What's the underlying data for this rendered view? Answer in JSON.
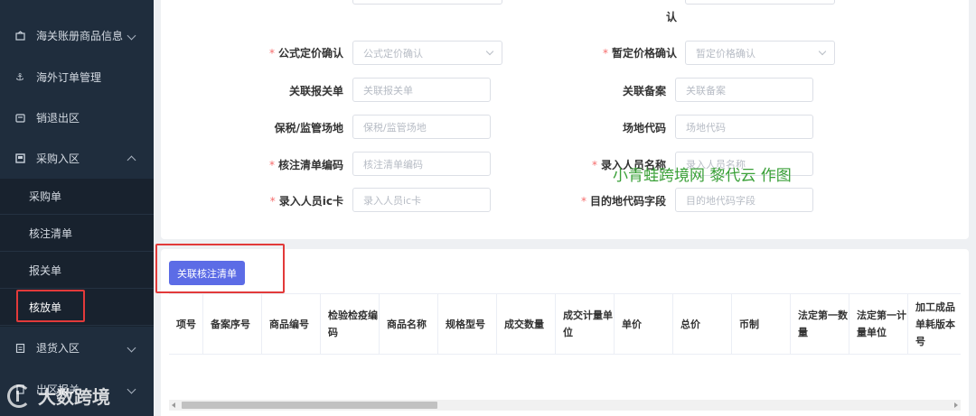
{
  "sidebar": {
    "menu": [
      {
        "label": "海关账册商品信息",
        "icon": "box-icon"
      },
      {
        "label": "海外订单管理",
        "icon": "anchor-icon"
      },
      {
        "label": "销退出区",
        "icon": "return-icon"
      },
      {
        "label": "采购入区",
        "icon": "square-icon",
        "expanded": true
      }
    ],
    "submenu": [
      "采购单",
      "核注清单",
      "报关单",
      "核放单"
    ],
    "active_submenu": "核放单",
    "menu_after": [
      {
        "label": "退货入区",
        "icon": "clipboard-icon"
      },
      {
        "label": "出区报关",
        "icon": "doc-icon"
      }
    ]
  },
  "form": {
    "partial_tail": "认",
    "rows": [
      {
        "left": {
          "label": "公式定价确认",
          "required": true,
          "placeholder": "公式定价确认",
          "type": "select"
        },
        "right": {
          "label": "暂定价格确认",
          "required": true,
          "placeholder": "暂定价格确认",
          "type": "select"
        }
      },
      {
        "left": {
          "label": "关联报关单",
          "required": false,
          "placeholder": "关联报关单",
          "type": "input"
        },
        "right": {
          "label": "关联备案",
          "required": false,
          "placeholder": "关联备案",
          "type": "input"
        }
      },
      {
        "left": {
          "label": "保税/监管场地",
          "required": false,
          "placeholder": "保税/监管场地",
          "type": "input"
        },
        "right": {
          "label": "场地代码",
          "required": false,
          "placeholder": "场地代码",
          "type": "input"
        }
      },
      {
        "left": {
          "label": "核注清单编码",
          "required": true,
          "placeholder": "核注清单编码",
          "type": "input"
        },
        "right": {
          "label": "录入人员名称",
          "required": true,
          "placeholder": "录入人员名称",
          "type": "input"
        }
      },
      {
        "left": {
          "label": "录入人员ic卡",
          "required": true,
          "placeholder": "录入人员ic卡",
          "type": "input"
        },
        "right": {
          "label": "目的地代码字段",
          "required": true,
          "placeholder": "目的地代码字段",
          "type": "input"
        }
      }
    ]
  },
  "watermark": "小青蛙跨境网 黎代云 作图",
  "actions": {
    "link_button": "关联核注清单"
  },
  "table": {
    "columns": [
      "项号",
      "备案序号",
      "商品编号",
      "检验检疫编码",
      "商品名称",
      "规格型号",
      "成交数量",
      "成交计量单位",
      "单价",
      "总价",
      "币制",
      "法定第一数量",
      "法定第一计量单位",
      "加工成品单耗版本号"
    ]
  },
  "corner_logo": "大数跨境",
  "colors": {
    "primary": "#5c6ce6",
    "required": "#f56c6c",
    "sidebar": "#1f2d3d",
    "highlight": "#e23a3a"
  }
}
